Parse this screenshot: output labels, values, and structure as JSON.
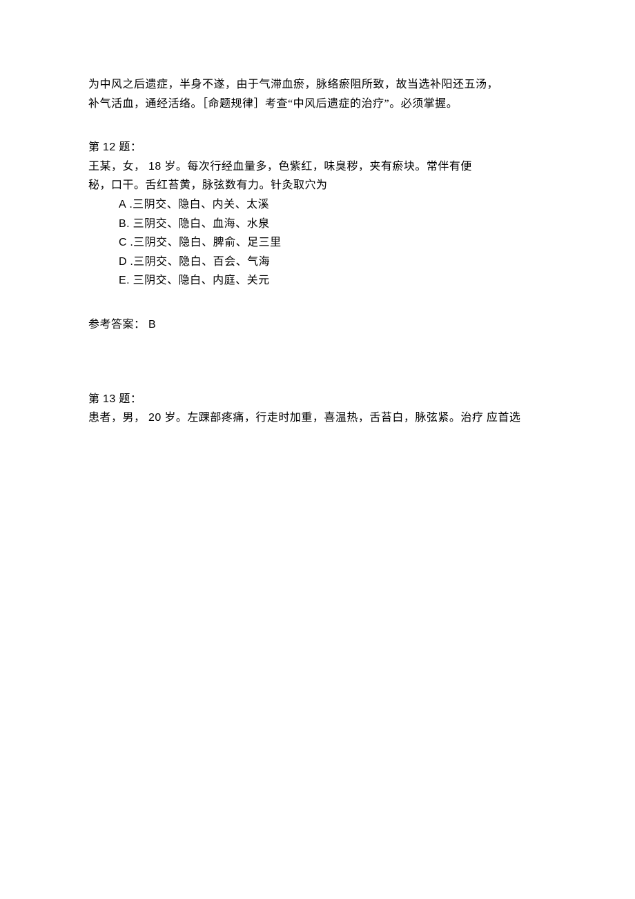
{
  "prevAnswer": {
    "line1": "为中风之后遗症，半身不遂，由于气滞血瘀，脉络瘀阻所致，故当选补阳还五汤，",
    "line2": "补气活血，通经活络。［命题规律］考查“中风后遗症的治疗”。必须掌握。"
  },
  "q12": {
    "header_prefix": "第 ",
    "header_num": "12",
    "header_suffix": " 题：",
    "text_line1_a": "王某，女， ",
    "text_line1_num": "18",
    "text_line1_b": " 岁。每次行经血量多，色紫红，味臭秽，夹有瘀块。常伴有便",
    "text_line2": "秘，口干。舌红苔黄，脉弦数有力。针灸取穴为",
    "options": {
      "A_label": "A",
      "A_text": " .三阴交、隐白、内关、太溪",
      "B_label": "B.",
      "B_text": " 三阴交、隐白、血海、水泉",
      "C_label": "C",
      "C_text": " .三阴交、隐白、脾俞、足三里",
      "D_label": "D",
      "D_text": " .三阴交、隐白、百会、气海",
      "E_label": "E.",
      "E_text": " 三阴交、隐白、内庭、关元"
    },
    "answer_label": "参考答案： ",
    "answer_value": "B"
  },
  "q13": {
    "header_prefix": "第 ",
    "header_num": "13",
    "header_suffix": " 题：",
    "text_a": "患者，男， ",
    "text_num": "20",
    "text_b": " 岁。左踝部疼痛，行走时加重，喜温热，舌苔白，脉弦紧。治疗 应首选"
  }
}
